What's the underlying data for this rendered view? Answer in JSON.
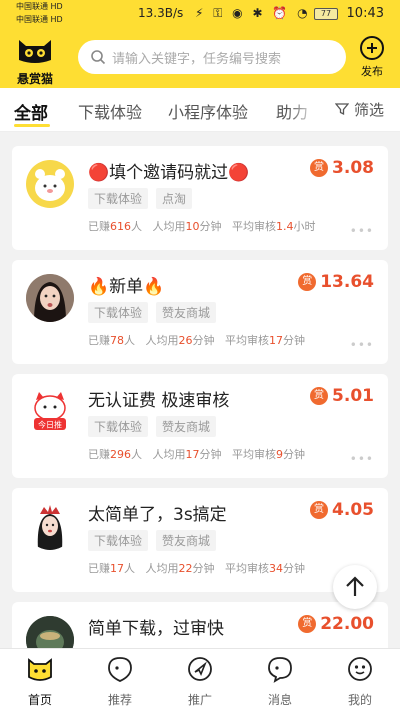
{
  "status_bar": {
    "carrier1": "中国联通 HD",
    "carrier2": "中国联通 HD",
    "speed": "13.3B/s",
    "battery": "77",
    "time": "10:43"
  },
  "header": {
    "logo_text": "悬赏猫",
    "search_placeholder": "请输入关键字，任务编号搜索",
    "publish_label": "发布"
  },
  "tabs": {
    "items": [
      "全部",
      "下载体验",
      "小程序体验",
      "助力"
    ],
    "active": "全部",
    "filter_label": "筛选"
  },
  "tasks": [
    {
      "title": "🔴填个邀请码就过🔴",
      "tags": [
        "下载体验",
        "点淘"
      ],
      "earned": "616",
      "avg_time": "10",
      "avg_review": "1.4",
      "review_unit": "小时",
      "reward": "3.08"
    },
    {
      "title": "🔥新单🔥",
      "tags": [
        "下载体验",
        "赞友商城"
      ],
      "earned": "78",
      "avg_time": "26",
      "avg_review": "17",
      "review_unit": "分钟",
      "reward": "13.64"
    },
    {
      "title": "无认证费  极速审核",
      "tags": [
        "下载体验",
        "赞友商城"
      ],
      "earned": "296",
      "avg_time": "17",
      "avg_review": "9",
      "review_unit": "分钟",
      "reward": "5.01"
    },
    {
      "title": "太简单了，3s搞定",
      "tags": [
        "下载体验",
        "赞友商城"
      ],
      "earned": "17",
      "avg_time": "22",
      "avg_review": "34",
      "review_unit": "分钟",
      "reward": "4.05"
    },
    {
      "title": "简单下载，过审快",
      "tags": [],
      "earned": "",
      "avg_time": "",
      "avg_review": "",
      "review_unit": "",
      "reward": "22.00"
    }
  ],
  "labels": {
    "earned_prefix": "已赚",
    "earned_suffix": "人",
    "avg_time_prefix": "人均用",
    "avg_time_suffix": "分钟",
    "review_prefix": "平均审核",
    "reward_badge": "赏",
    "avatar3_text": "今日推"
  },
  "bottom_nav": [
    {
      "label": "首页",
      "icon": "home-cat-icon"
    },
    {
      "label": "推荐",
      "icon": "recommend-icon"
    },
    {
      "label": "推广",
      "icon": "promote-icon"
    },
    {
      "label": "消息",
      "icon": "message-icon"
    },
    {
      "label": "我的",
      "icon": "profile-icon"
    }
  ],
  "colors": {
    "brand": "#fede33",
    "reward": "#e8502d"
  }
}
